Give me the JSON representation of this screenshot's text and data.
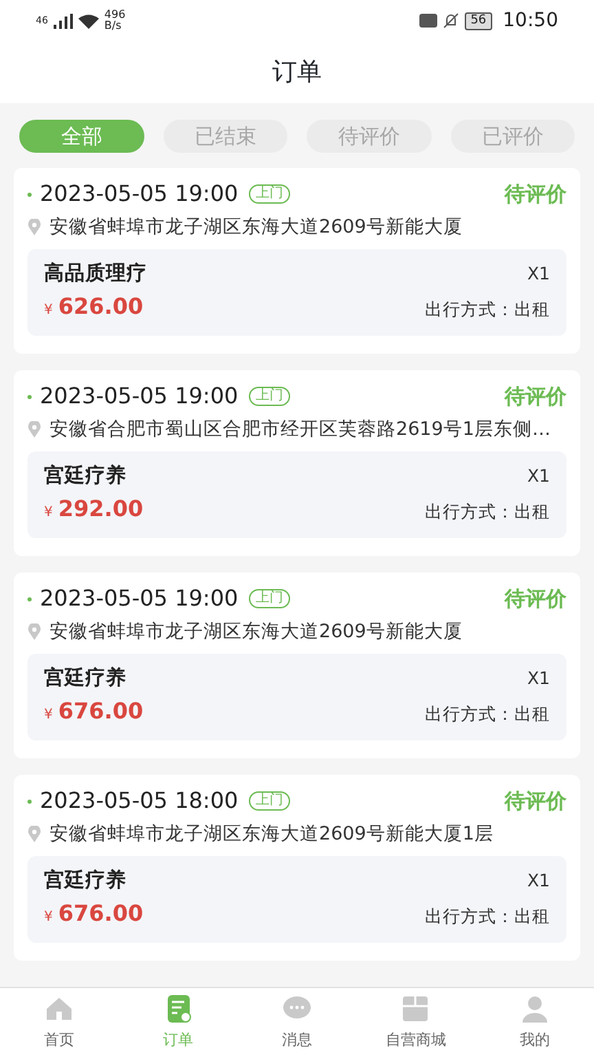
{
  "status_bar": {
    "network": "46",
    "speed": "496",
    "speed_unit": "B/s",
    "battery": "56",
    "time": "10:50"
  },
  "title": "订单",
  "tabs": [
    {
      "label": "全部",
      "selected": true
    },
    {
      "label": "已结束",
      "selected": false
    },
    {
      "label": "待评价",
      "selected": false
    },
    {
      "label": "已评价",
      "selected": false
    }
  ],
  "orders": [
    {
      "time": "2023-05-05 19:00",
      "tag": "上门",
      "status": "待评价",
      "address": "安徽省蚌埠市龙子湖区东海大道2609号新能大厦",
      "product": "高品质理疗",
      "quantity": "X1",
      "currency": "¥",
      "price": "626.00",
      "travel": "出行方式：出租"
    },
    {
      "time": "2023-05-05 19:00",
      "tag": "上门",
      "status": "待评价",
      "address": "安徽省合肥市蜀山区合肥市经开区芙蓉路2619号1层东侧…",
      "product": "宫廷疗养",
      "quantity": "X1",
      "currency": "¥",
      "price": "292.00",
      "travel": "出行方式：出租"
    },
    {
      "time": "2023-05-05 19:00",
      "tag": "上门",
      "status": "待评价",
      "address": "安徽省蚌埠市龙子湖区东海大道2609号新能大厦",
      "product": "宫廷疗养",
      "quantity": "X1",
      "currency": "¥",
      "price": "676.00",
      "travel": "出行方式：出租"
    },
    {
      "time": "2023-05-05 18:00",
      "tag": "上门",
      "status": "待评价",
      "address": "安徽省蚌埠市龙子湖区东海大道2609号新能大厦1层",
      "product": "宫廷疗养",
      "quantity": "X1",
      "currency": "¥",
      "price": "676.00",
      "travel": "出行方式：出租"
    }
  ],
  "bottom_nav": [
    {
      "label": "首页",
      "kind": "home",
      "selected": false
    },
    {
      "label": "订单",
      "kind": "orders",
      "selected": true
    },
    {
      "label": "消息",
      "kind": "messages",
      "selected": false
    },
    {
      "label": "自营商城",
      "kind": "shop",
      "selected": false
    },
    {
      "label": "我的",
      "kind": "profile",
      "selected": false
    }
  ]
}
